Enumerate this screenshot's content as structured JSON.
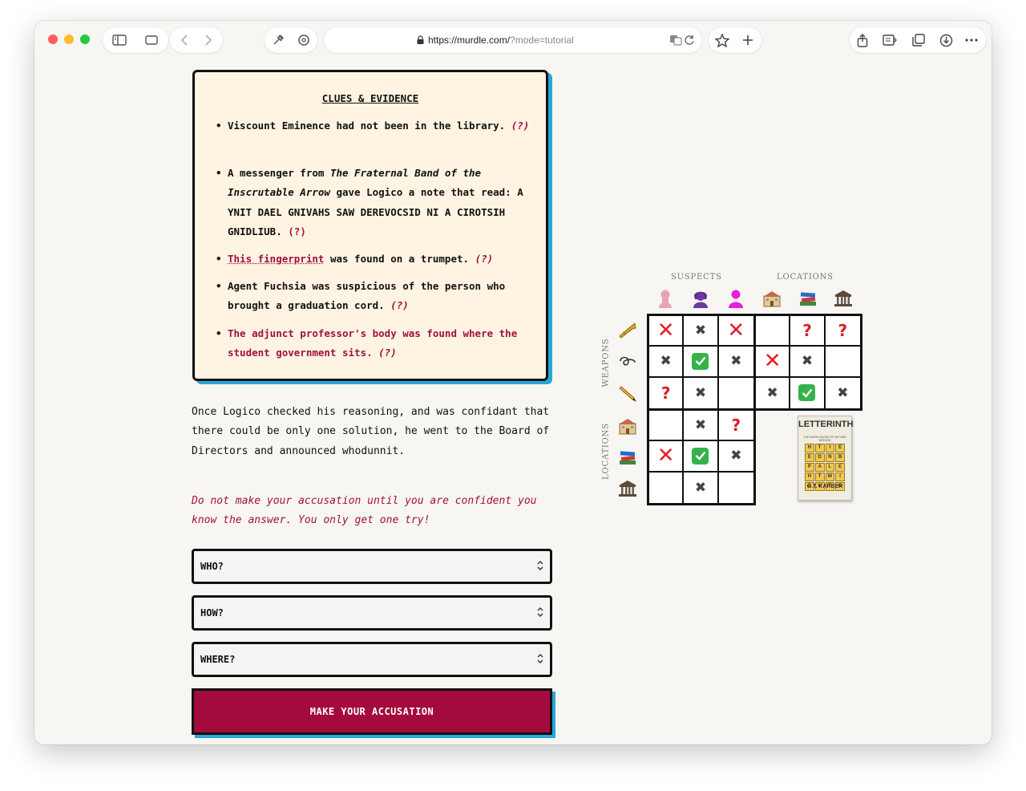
{
  "browser": {
    "url_host": "https://murdle.com/",
    "url_query": "?mode=tutorial",
    "icons": [
      "sidebar-icon",
      "tab-overview-icon",
      "back-icon",
      "forward-icon",
      "extensions-icon",
      "settings-icon",
      "lock-icon",
      "translate-icon",
      "reload-icon",
      "bookmark-star-icon",
      "new-tab-icon",
      "share-icon",
      "reader-icon",
      "tabs-icon",
      "download-icon",
      "more-icon"
    ]
  },
  "clues": {
    "title": "CLUES & EVIDENCE",
    "items": [
      {
        "text": "Viscount Eminence had not been in the library.",
        "hint": "(?)"
      },
      {
        "pre": "A messenger from ",
        "italic": "The Fraternal Band of the Inscrutable Arrow",
        "post": " gave Logico a note that read: A YNIT DAEL GNIVAHS SAW DEREVOCSID NI A CIROTSIH GNIDLIUB.",
        "hint": "(?)"
      },
      {
        "link": "This fingerprint",
        "text": " was found on a trumpet.",
        "hint": "(?)"
      },
      {
        "text": "Agent Fuchsia was suspicious of the person who brought a graduation cord.",
        "hint": "(?)"
      },
      {
        "text": "The adjunct professor's body was found where the student government sits.",
        "hint": "(?)"
      }
    ]
  },
  "story": "Once Logico checked his reasoning, and was confidant that there could be only one solution, he went to the Board of Directors and announced whodunnit.",
  "warning": "Do not make your accusation until you are confident you know the answer. You only get one try!",
  "form": {
    "who": "WHO?",
    "how": "HOW?",
    "where": "WHERE?",
    "submit": "MAKE YOUR ACCUSATION"
  },
  "grid": {
    "suspects_label": "SUSPECTS",
    "locations_label": "LOCATIONS",
    "weapons_label": "WEAPONS",
    "locations_side_label": "LOCATIONS",
    "suspect_icons": [
      "suspect-pink-icon",
      "suspect-purple-icon",
      "suspect-fuchsia-icon"
    ],
    "location_icons": [
      "school-building-icon",
      "books-icon",
      "classical-building-icon"
    ],
    "weapon_icons": [
      "trumpet-icon",
      "graduation-cord-icon",
      "pencil-icon"
    ],
    "weapons_vs_suspects": [
      [
        "red-x",
        "x",
        "red-x"
      ],
      [
        "x",
        "check",
        "x"
      ],
      [
        "?",
        "x",
        ""
      ]
    ],
    "weapons_vs_locations": [
      [
        "",
        "?",
        "?"
      ],
      [
        "red-x",
        "x",
        ""
      ],
      [
        "x",
        "check",
        "x"
      ]
    ],
    "locations_vs_suspects": [
      [
        "",
        "x",
        "?"
      ],
      [
        "red-x",
        "check",
        "x"
      ],
      [
        "",
        "x",
        ""
      ]
    ]
  },
  "ad": {
    "title": "LETTERINTH",
    "subtitle": "THE WORD MAZES OF WIT AND WISDOM",
    "tiles": [
      "H",
      "T",
      "I",
      "E",
      "E",
      "D",
      "N",
      "B",
      "P",
      "A",
      "L",
      "E",
      "H",
      "T",
      "W",
      "I",
      "O",
      "U",
      "T",
      "O"
    ],
    "author": "G.T. KARBER"
  }
}
